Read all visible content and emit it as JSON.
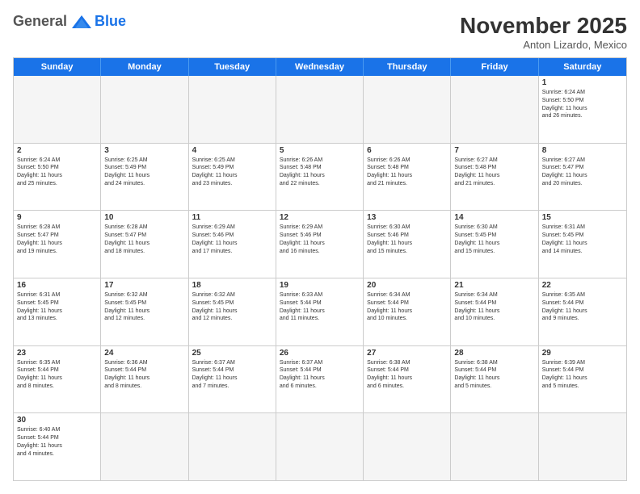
{
  "header": {
    "logo_general": "General",
    "logo_blue": "Blue",
    "month_title": "November 2025",
    "subtitle": "Anton Lizardo, Mexico"
  },
  "days_of_week": [
    "Sunday",
    "Monday",
    "Tuesday",
    "Wednesday",
    "Thursday",
    "Friday",
    "Saturday"
  ],
  "weeks": [
    [
      {
        "day": "",
        "empty": true,
        "lines": []
      },
      {
        "day": "",
        "empty": true,
        "lines": []
      },
      {
        "day": "",
        "empty": true,
        "lines": []
      },
      {
        "day": "",
        "empty": true,
        "lines": []
      },
      {
        "day": "",
        "empty": true,
        "lines": []
      },
      {
        "day": "",
        "empty": true,
        "lines": []
      },
      {
        "day": "1",
        "empty": false,
        "lines": [
          "Sunrise: 6:24 AM",
          "Sunset: 5:50 PM",
          "Daylight: 11 hours",
          "and 26 minutes."
        ]
      }
    ],
    [
      {
        "day": "2",
        "empty": false,
        "lines": [
          "Sunrise: 6:24 AM",
          "Sunset: 5:50 PM",
          "Daylight: 11 hours",
          "and 25 minutes."
        ]
      },
      {
        "day": "3",
        "empty": false,
        "lines": [
          "Sunrise: 6:25 AM",
          "Sunset: 5:49 PM",
          "Daylight: 11 hours",
          "and 24 minutes."
        ]
      },
      {
        "day": "4",
        "empty": false,
        "lines": [
          "Sunrise: 6:25 AM",
          "Sunset: 5:49 PM",
          "Daylight: 11 hours",
          "and 23 minutes."
        ]
      },
      {
        "day": "5",
        "empty": false,
        "lines": [
          "Sunrise: 6:26 AM",
          "Sunset: 5:48 PM",
          "Daylight: 11 hours",
          "and 22 minutes."
        ]
      },
      {
        "day": "6",
        "empty": false,
        "lines": [
          "Sunrise: 6:26 AM",
          "Sunset: 5:48 PM",
          "Daylight: 11 hours",
          "and 21 minutes."
        ]
      },
      {
        "day": "7",
        "empty": false,
        "lines": [
          "Sunrise: 6:27 AM",
          "Sunset: 5:48 PM",
          "Daylight: 11 hours",
          "and 21 minutes."
        ]
      },
      {
        "day": "8",
        "empty": false,
        "lines": [
          "Sunrise: 6:27 AM",
          "Sunset: 5:47 PM",
          "Daylight: 11 hours",
          "and 20 minutes."
        ]
      }
    ],
    [
      {
        "day": "9",
        "empty": false,
        "lines": [
          "Sunrise: 6:28 AM",
          "Sunset: 5:47 PM",
          "Daylight: 11 hours",
          "and 19 minutes."
        ]
      },
      {
        "day": "10",
        "empty": false,
        "lines": [
          "Sunrise: 6:28 AM",
          "Sunset: 5:47 PM",
          "Daylight: 11 hours",
          "and 18 minutes."
        ]
      },
      {
        "day": "11",
        "empty": false,
        "lines": [
          "Sunrise: 6:29 AM",
          "Sunset: 5:46 PM",
          "Daylight: 11 hours",
          "and 17 minutes."
        ]
      },
      {
        "day": "12",
        "empty": false,
        "lines": [
          "Sunrise: 6:29 AM",
          "Sunset: 5:46 PM",
          "Daylight: 11 hours",
          "and 16 minutes."
        ]
      },
      {
        "day": "13",
        "empty": false,
        "lines": [
          "Sunrise: 6:30 AM",
          "Sunset: 5:46 PM",
          "Daylight: 11 hours",
          "and 15 minutes."
        ]
      },
      {
        "day": "14",
        "empty": false,
        "lines": [
          "Sunrise: 6:30 AM",
          "Sunset: 5:45 PM",
          "Daylight: 11 hours",
          "and 15 minutes."
        ]
      },
      {
        "day": "15",
        "empty": false,
        "lines": [
          "Sunrise: 6:31 AM",
          "Sunset: 5:45 PM",
          "Daylight: 11 hours",
          "and 14 minutes."
        ]
      }
    ],
    [
      {
        "day": "16",
        "empty": false,
        "lines": [
          "Sunrise: 6:31 AM",
          "Sunset: 5:45 PM",
          "Daylight: 11 hours",
          "and 13 minutes."
        ]
      },
      {
        "day": "17",
        "empty": false,
        "lines": [
          "Sunrise: 6:32 AM",
          "Sunset: 5:45 PM",
          "Daylight: 11 hours",
          "and 12 minutes."
        ]
      },
      {
        "day": "18",
        "empty": false,
        "lines": [
          "Sunrise: 6:32 AM",
          "Sunset: 5:45 PM",
          "Daylight: 11 hours",
          "and 12 minutes."
        ]
      },
      {
        "day": "19",
        "empty": false,
        "lines": [
          "Sunrise: 6:33 AM",
          "Sunset: 5:44 PM",
          "Daylight: 11 hours",
          "and 11 minutes."
        ]
      },
      {
        "day": "20",
        "empty": false,
        "lines": [
          "Sunrise: 6:34 AM",
          "Sunset: 5:44 PM",
          "Daylight: 11 hours",
          "and 10 minutes."
        ]
      },
      {
        "day": "21",
        "empty": false,
        "lines": [
          "Sunrise: 6:34 AM",
          "Sunset: 5:44 PM",
          "Daylight: 11 hours",
          "and 10 minutes."
        ]
      },
      {
        "day": "22",
        "empty": false,
        "lines": [
          "Sunrise: 6:35 AM",
          "Sunset: 5:44 PM",
          "Daylight: 11 hours",
          "and 9 minutes."
        ]
      }
    ],
    [
      {
        "day": "23",
        "empty": false,
        "lines": [
          "Sunrise: 6:35 AM",
          "Sunset: 5:44 PM",
          "Daylight: 11 hours",
          "and 8 minutes."
        ]
      },
      {
        "day": "24",
        "empty": false,
        "lines": [
          "Sunrise: 6:36 AM",
          "Sunset: 5:44 PM",
          "Daylight: 11 hours",
          "and 8 minutes."
        ]
      },
      {
        "day": "25",
        "empty": false,
        "lines": [
          "Sunrise: 6:37 AM",
          "Sunset: 5:44 PM",
          "Daylight: 11 hours",
          "and 7 minutes."
        ]
      },
      {
        "day": "26",
        "empty": false,
        "lines": [
          "Sunrise: 6:37 AM",
          "Sunset: 5:44 PM",
          "Daylight: 11 hours",
          "and 6 minutes."
        ]
      },
      {
        "day": "27",
        "empty": false,
        "lines": [
          "Sunrise: 6:38 AM",
          "Sunset: 5:44 PM",
          "Daylight: 11 hours",
          "and 6 minutes."
        ]
      },
      {
        "day": "28",
        "empty": false,
        "lines": [
          "Sunrise: 6:38 AM",
          "Sunset: 5:44 PM",
          "Daylight: 11 hours",
          "and 5 minutes."
        ]
      },
      {
        "day": "29",
        "empty": false,
        "lines": [
          "Sunrise: 6:39 AM",
          "Sunset: 5:44 PM",
          "Daylight: 11 hours",
          "and 5 minutes."
        ]
      }
    ],
    [
      {
        "day": "30",
        "empty": false,
        "lines": [
          "Sunrise: 6:40 AM",
          "Sunset: 5:44 PM",
          "Daylight: 11 hours",
          "and 4 minutes."
        ]
      },
      {
        "day": "",
        "empty": true,
        "lines": []
      },
      {
        "day": "",
        "empty": true,
        "lines": []
      },
      {
        "day": "",
        "empty": true,
        "lines": []
      },
      {
        "day": "",
        "empty": true,
        "lines": []
      },
      {
        "day": "",
        "empty": true,
        "lines": []
      },
      {
        "day": "",
        "empty": true,
        "lines": []
      }
    ]
  ]
}
